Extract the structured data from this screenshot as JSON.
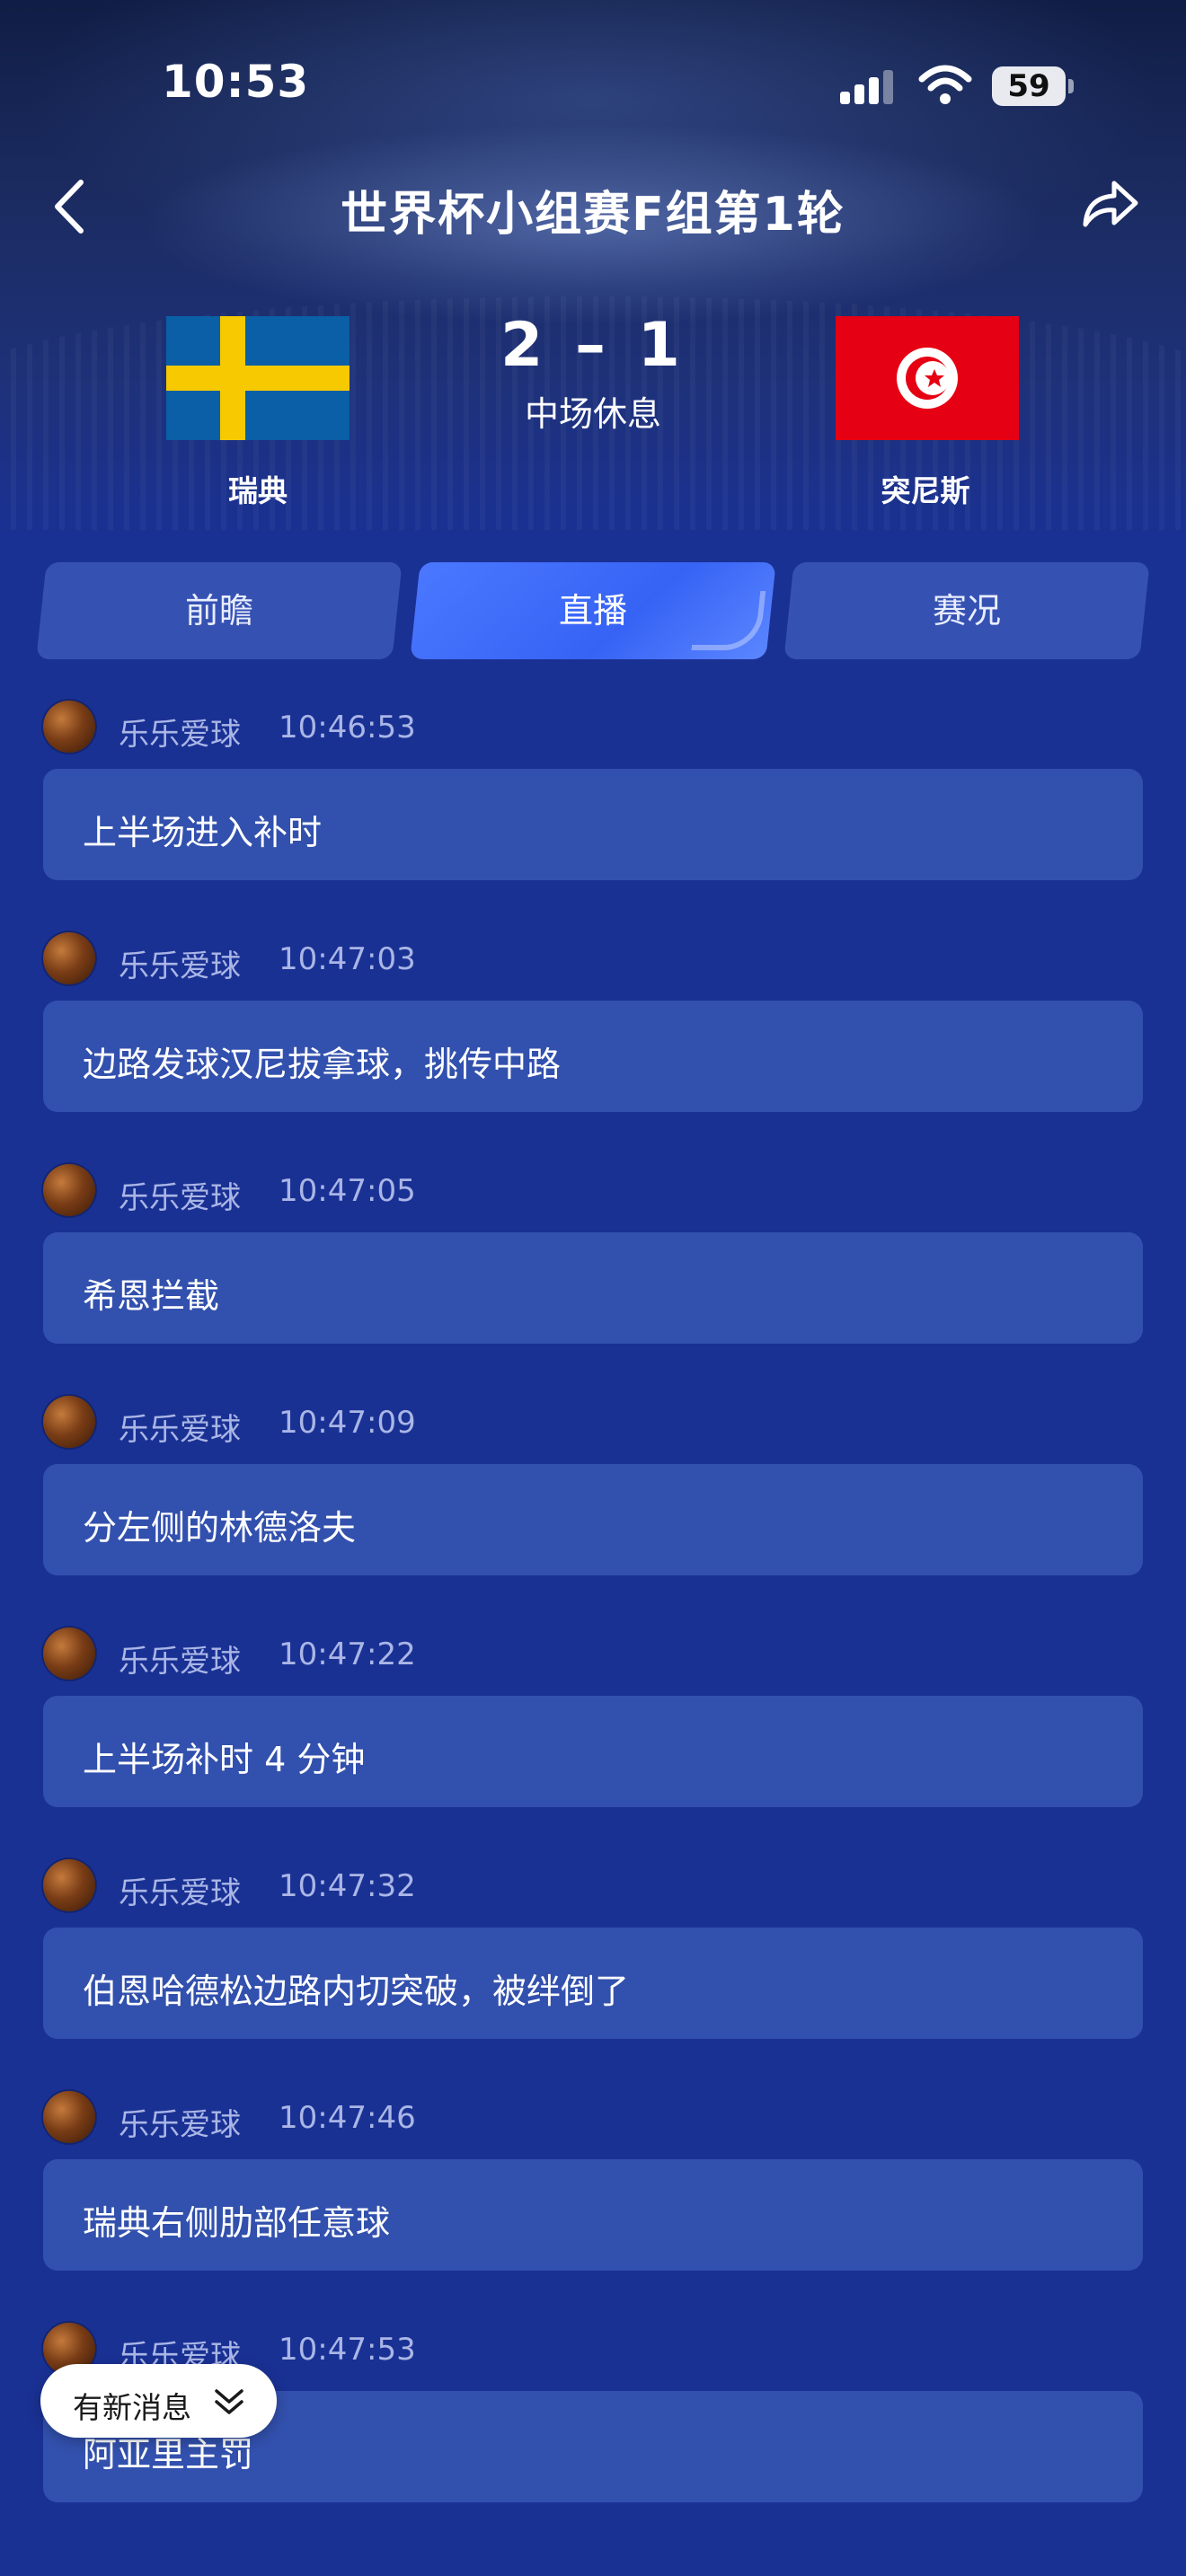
{
  "status_bar": {
    "time": "10:53",
    "battery": "59"
  },
  "header": {
    "title": "世界杯小组赛F组第1轮"
  },
  "match": {
    "home": {
      "name": "瑞典"
    },
    "away": {
      "name": "突尼斯"
    },
    "score": "2 – 1",
    "period": "中场休息"
  },
  "tabs": [
    {
      "label": "前瞻"
    },
    {
      "label": "直播"
    },
    {
      "label": "赛况"
    }
  ],
  "active_tab": "直播",
  "feed": [
    {
      "author": "乐乐爱球",
      "time": "10:46:53",
      "text": "上半场进入补时"
    },
    {
      "author": "乐乐爱球",
      "time": "10:47:03",
      "text": "边路发球汉尼拔拿球，挑传中路"
    },
    {
      "author": "乐乐爱球",
      "time": "10:47:05",
      "text": "希恩拦截"
    },
    {
      "author": "乐乐爱球",
      "time": "10:47:09",
      "text": "分左侧的林德洛夫"
    },
    {
      "author": "乐乐爱球",
      "time": "10:47:22",
      "text": "上半场补时 4 分钟"
    },
    {
      "author": "乐乐爱球",
      "time": "10:47:32",
      "text": "伯恩哈德松边路内切突破，被绊倒了"
    },
    {
      "author": "乐乐爱球",
      "time": "10:47:46",
      "text": "瑞典右侧肋部任意球"
    },
    {
      "author": "乐乐爱球",
      "time": "10:47:53",
      "text": "阿亚里主罚"
    }
  ],
  "new_messages": {
    "label": "有新消息"
  },
  "colors": {
    "background": "#1a3194",
    "bubble": "#3250ad",
    "active_tab": "#4b78ff",
    "sweden_blue": "#0a5fa6",
    "sweden_yellow": "#f7c900",
    "tunisia_red": "#e60013"
  }
}
